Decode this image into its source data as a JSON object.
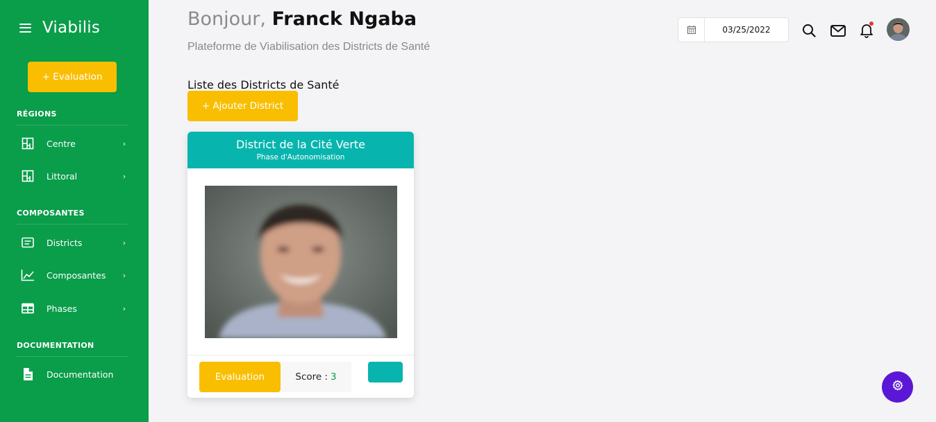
{
  "sidebar": {
    "brand": "Viabilis",
    "eval_button": "+ Evaluation",
    "sections": [
      {
        "title": "RÉGIONS",
        "items": [
          {
            "label": "Centre"
          },
          {
            "label": "Littoral"
          }
        ]
      },
      {
        "title": "COMPOSANTES",
        "items": [
          {
            "label": "Districts"
          },
          {
            "label": "Composantes"
          },
          {
            "label": "Phases"
          }
        ]
      },
      {
        "title": "DOCUMENTATION",
        "items": [
          {
            "label": "Documentation"
          }
        ]
      }
    ],
    "chevron": "›"
  },
  "header": {
    "greeting_prefix": "Bonjour,",
    "user_name": "Franck Ngaba",
    "subtitle": "Plateforme de Viabilisation des Districts de Santé",
    "date": "03/25/2022"
  },
  "main": {
    "list_title": "Liste des Districts de Santé",
    "add_button": "+ Ajouter District",
    "card": {
      "title": "District de la Cité Verte",
      "subtitle": "Phase d'Autonomisation",
      "eval_button": "Evaluation",
      "score_label": "Score :",
      "score_value": "3"
    }
  },
  "colors": {
    "sidebar": "#0a9d4a",
    "accent_yellow": "#f9be00",
    "teal": "#08b5ae",
    "fab_purple": "#5b17d6",
    "notification": "#e53935"
  },
  "icons": [
    "menu-icon",
    "map-icon",
    "list-icon",
    "chart-icon",
    "table-icon",
    "document-icon",
    "calendar-icon",
    "search-icon",
    "mail-icon",
    "bell-icon",
    "gear-icon"
  ]
}
